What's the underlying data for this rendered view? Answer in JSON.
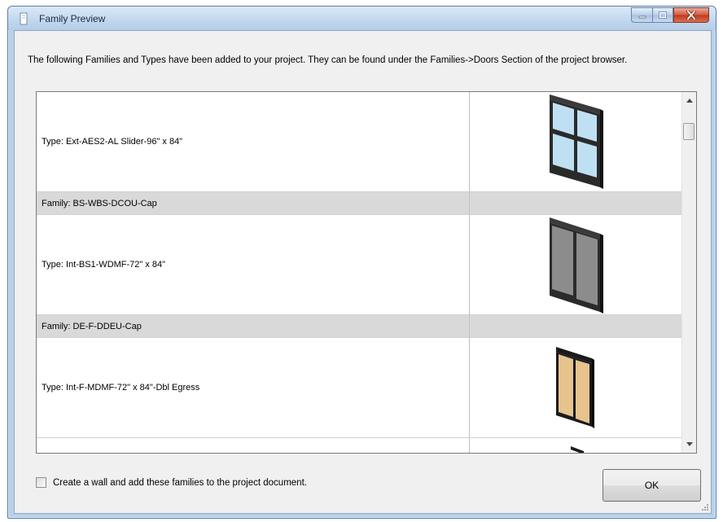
{
  "window": {
    "title": "Family Preview",
    "colors": {
      "titlebar": "#c3d8ef",
      "close_button": "#c2371d",
      "family_row": "#d9d9d9"
    }
  },
  "message": "The following Families and Types have been added to your project.  They can be found under the Families->Doors Section of the project browser.",
  "list": {
    "rows": [
      {
        "kind": "type",
        "label": "Type:  Ext-AES2-AL Slider-96\" x 84\"",
        "preview_icon": "aluminum-slider-door-icon"
      },
      {
        "kind": "family",
        "label": "Family:  BS-WBS-DCOU-Cap"
      },
      {
        "kind": "type",
        "label": "Type:  Int-BS1-WDMF-72\" x 84\"",
        "preview_icon": "gray-double-door-icon"
      },
      {
        "kind": "family",
        "label": "Family:  DE-F-DDEU-Cap"
      },
      {
        "kind": "type",
        "label": "Type:  Int-F-MDMF-72\" x 84\"-Dbl Egress",
        "preview_icon": "wood-double-egress-door-icon"
      },
      {
        "kind": "type",
        "label": ""
      }
    ]
  },
  "footer": {
    "checkbox_label": "Create a wall and add these families to the project document.",
    "checkbox_checked": false,
    "ok_label": "OK"
  }
}
